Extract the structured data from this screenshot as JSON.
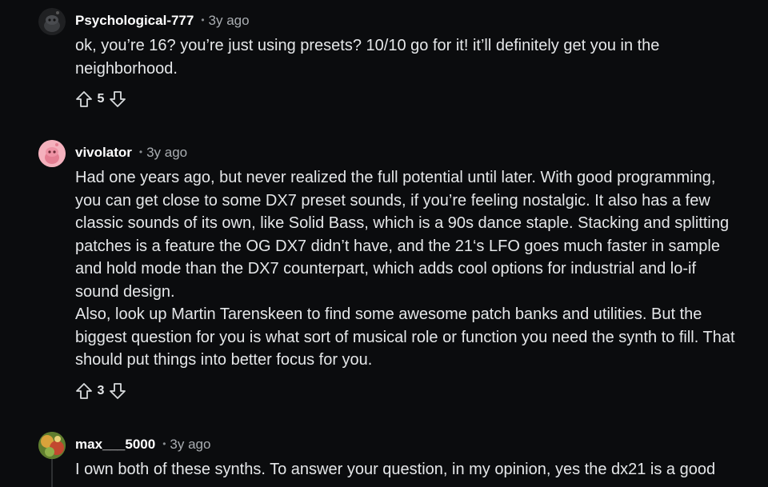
{
  "comments": [
    {
      "username": "Psychological-777",
      "separator": "•",
      "time": "3y ago",
      "avatar": "snoo-dark-avatar",
      "body": [
        "ok, you’re 16? you’re just using presets? 10/10 go for it! it’ll definitely get you in the neighborhood."
      ],
      "votes": "5"
    },
    {
      "username": "vivolator",
      "separator": "•",
      "time": "3y ago",
      "avatar": "snoo-pink-avatar",
      "body": [
        "Had one years ago, but never realized the full potential until later. With good programming, you can get close to some DX7 preset sounds, if you’re feeling nostalgic. It also has a few classic sounds of its own, like Solid Bass, which is a 90s dance staple. Stacking and splitting patches is a feature the OG DX7 didn’t have, and the 21‘s LFO goes much faster in sample and hold mode than the DX7 counterpart, which adds cool options for industrial and lo-if sound design.",
        "Also, look up Martin Tarenskeen to find some awesome patch banks and utilities. But the biggest question for you is what sort of musical role or function you need the synth to fill. That should put things into better focus for you."
      ],
      "votes": "3"
    },
    {
      "username": "max___5000",
      "separator": "•",
      "time": "3y ago",
      "avatar": "colorful-photo-avatar",
      "body": [
        "I own both of these synths. To answer your question, in my opinion, yes the dx21 is a good"
      ],
      "votes": ""
    }
  ],
  "icons": {
    "upvote": "arrow-up-outline-icon",
    "downvote": "arrow-down-outline-icon"
  },
  "colors": {
    "background": "#0b0c0e",
    "text": "#e5e7e9",
    "username": "#ffffff",
    "muted": "#a9adb1"
  }
}
